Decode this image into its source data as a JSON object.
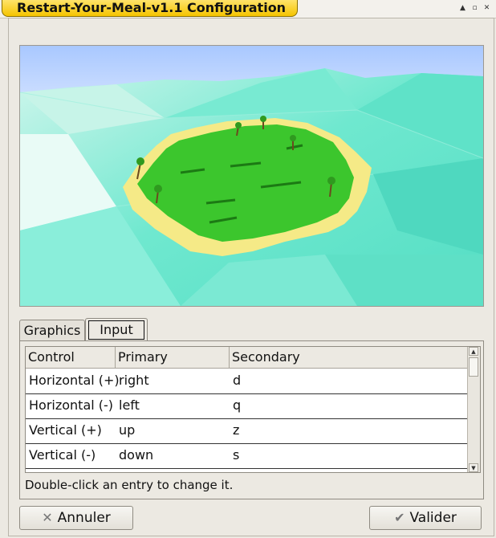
{
  "window": {
    "title": "Restart-Your-Meal-v1.1 Configuration",
    "controls": [
      "minimize-icon",
      "maximize-icon",
      "close-icon"
    ]
  },
  "preview": {
    "image": "3d hexagonal island scene preview"
  },
  "tabs": [
    {
      "label": "Graphics",
      "selected": false
    },
    {
      "label": "Input",
      "selected": true
    }
  ],
  "bindings_table": {
    "headers": [
      "Control",
      "Primary",
      "Secondary"
    ],
    "rows": [
      {
        "control": "Horizontal (+)",
        "primary": "right",
        "secondary": "d"
      },
      {
        "control": "Horizontal (-)",
        "primary": "left",
        "secondary": "q"
      },
      {
        "control": "Vertical (+)",
        "primary": "up",
        "secondary": "z"
      },
      {
        "control": "Vertical (-)",
        "primary": "down",
        "secondary": "s"
      }
    ]
  },
  "hint": "Double-click an entry to change it.",
  "buttons": {
    "cancel": {
      "label": "Annuler",
      "icon": "x-icon"
    },
    "ok": {
      "label": "Valider",
      "icon": "checkmark-icon"
    }
  }
}
